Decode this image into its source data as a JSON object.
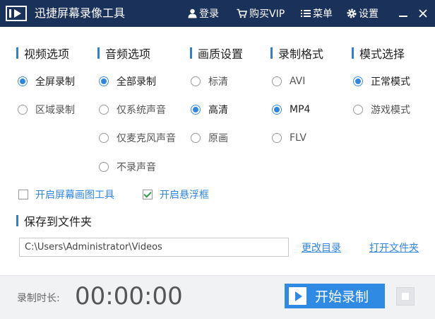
{
  "titlebar": {
    "title": "迅捷屏幕录像工具",
    "login": "登录",
    "buy_vip": "购买VIP",
    "menu": "菜单",
    "settings": "设置"
  },
  "sections": {
    "video": {
      "title": "视频选项",
      "options": [
        "全屏录制",
        "区域录制"
      ],
      "selected": "全屏录制"
    },
    "audio": {
      "title": "音频选项",
      "options": [
        "全部录制",
        "仅系统声音",
        "仅麦克风声音",
        "不录声音"
      ],
      "selected": "全部录制"
    },
    "quality": {
      "title": "画质设置",
      "options": [
        "标清",
        "高清",
        "原画"
      ],
      "selected": "高清"
    },
    "format": {
      "title": "录制格式",
      "options": [
        "AVI",
        "MP4",
        "FLV"
      ],
      "selected": "MP4"
    },
    "mode": {
      "title": "模式选择",
      "options": [
        "正常模式",
        "游戏模式"
      ],
      "selected": "正常模式"
    }
  },
  "checkboxes": {
    "draw_tool": {
      "label": "开启屏幕画图工具",
      "checked": false
    },
    "float_window": {
      "label": "开启悬浮框",
      "checked": true
    }
  },
  "save": {
    "title": "保存到文件夹",
    "path": "C:\\Users\\Administrator\\Videos",
    "change_dir": "更改目录",
    "open_folder": "打开文件夹"
  },
  "bottom": {
    "duration_label": "录制时长:",
    "timer": "00:00:00",
    "start_label": "开始录制"
  },
  "colors": {
    "titlebar_bg": "#1a3159",
    "accent": "#2f86e0",
    "check_green": "#2e9a4e"
  }
}
